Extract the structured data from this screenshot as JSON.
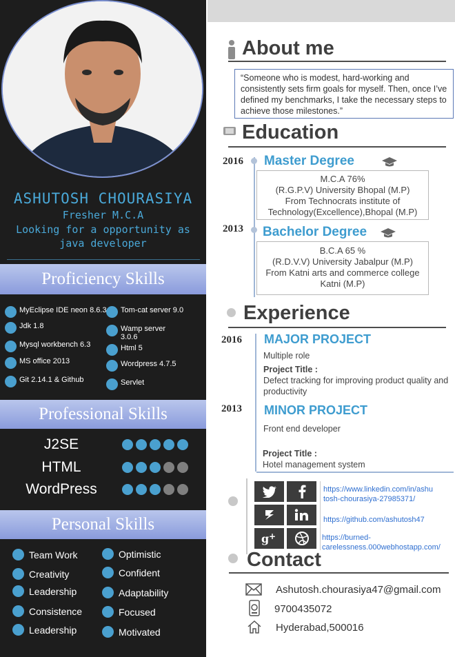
{
  "profile": {
    "name": "ASHUTOSH CHOURASIYA",
    "subtitle": "Fresher M.C.A",
    "tagline_1": "Looking for a opportunity as",
    "tagline_2": "java developer"
  },
  "proficiency": {
    "title": "Proficiency Skills",
    "left": [
      "MyEclipse IDE neon 8.6.3",
      "Jdk 1.8",
      "Mysql workbench 6.3",
      "MS office 2013",
      "Git 2.14.1 & Github"
    ],
    "right": [
      "Tom-cat server 9.0",
      "Wamp server 3.0.6",
      "Html 5",
      "Wordpress 4.7.5",
      "Servlet"
    ]
  },
  "professional": {
    "title": "Professional  Skills",
    "items": [
      {
        "label": "J2SE",
        "rating": 5,
        "max": 5
      },
      {
        "label": "HTML",
        "rating": 3,
        "max": 5
      },
      {
        "label": "WordPress",
        "rating": 3,
        "max": 5
      }
    ]
  },
  "personal": {
    "title": "Personal Skills",
    "left": [
      "Team Work",
      "Creativity",
      "Leadership",
      "Consistence",
      "Leadership"
    ],
    "right": [
      "Optimistic",
      "Confident",
      "Adaptability",
      "Focused",
      "Motivated"
    ]
  },
  "about": {
    "title": "About me",
    "quote": "“Someone who is modest, hard-working  and consistently sets firm goals for myself. Then, once I’ve defined my benchmarks, I take the necessary steps to achieve those milestones.”"
  },
  "education": {
    "title": "Education",
    "items": [
      {
        "year": "2016",
        "degree": "Master   Degree",
        "lines": [
          "M.C.A      76%",
          "(R.G.P.V) University Bhopal (M.P)",
          "From Technocrats institute of",
          "Technology(Excellence),Bhopal (M.P)"
        ]
      },
      {
        "year": "2013",
        "degree": "Bachelor Degree",
        "lines": [
          "B.C.A     65 %",
          "(R.D.V.V) University Jabalpur  (M.P)",
          "From Katni arts and commerce college",
          "Katni  (M.P)"
        ]
      }
    ]
  },
  "experience": {
    "title": "Experience",
    "items": [
      {
        "year": "2016",
        "title": "MAJOR PROJECT",
        "role": "Multiple  role",
        "pt_label": "Project Title :",
        "pt_text": "Defect tracking  for improving  product quality and productivity"
      },
      {
        "year": "2013",
        "title": "MINOR PROJECT",
        "role": "Front end developer",
        "pt_label": "Project Title :",
        "pt_text": "Hotel management system"
      }
    ]
  },
  "social": {
    "icons": [
      "twitter-icon",
      "facebook-icon",
      "stackoverflow-icon",
      "linkedin-icon",
      "google-plus-icon",
      "dribbble-icon"
    ],
    "links": [
      "https://www.linkedin.com/in/ashu tosh-chourasiya-27985371/",
      "https://github.com/ashutosh47",
      "https://burned- carelessness.000webhostapp.com/"
    ]
  },
  "contact": {
    "title": "Contact",
    "email": "Ashutosh.chourasiya47@gmail.com",
    "phone": "9700435072",
    "address": "Hyderabad,500016"
  },
  "colors": {
    "accent": "#3e9ccf",
    "band": "#8a9bdc",
    "sidebar": "#1d1d1d"
  }
}
